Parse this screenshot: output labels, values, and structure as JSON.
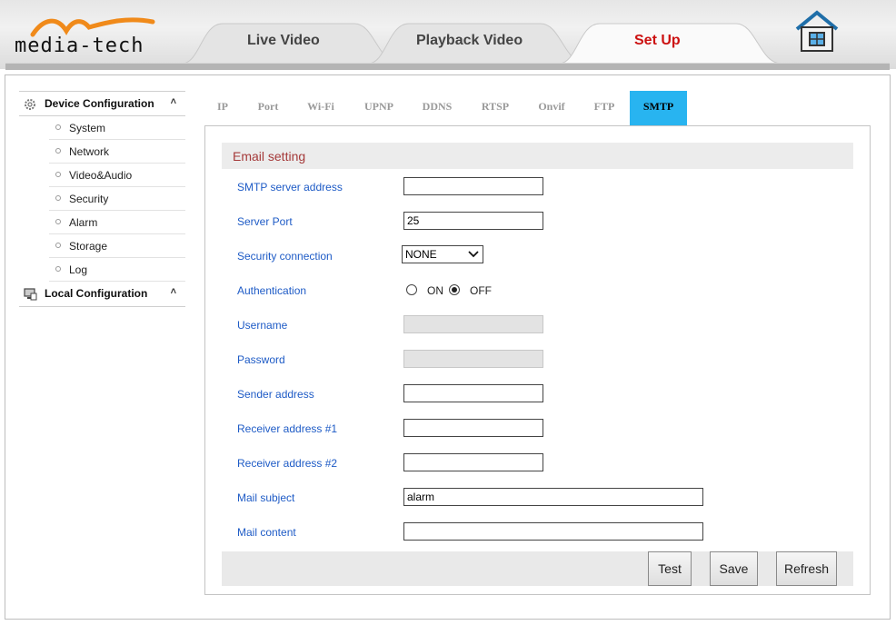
{
  "header": {
    "logo_text": "media-tech",
    "tabs": [
      {
        "label": "Live Video",
        "active": false
      },
      {
        "label": "Playback Video",
        "active": false
      },
      {
        "label": "Set Up",
        "active": true
      }
    ],
    "home_icon": "home-icon",
    "colors": {
      "active_tab_text": "#cc1111",
      "inactive_tab_text": "#444444"
    }
  },
  "sidebar": {
    "device_config": {
      "label": "Device Configuration",
      "icon": "gear-icon",
      "items": [
        {
          "label": "System"
        },
        {
          "label": "Network"
        },
        {
          "label": "Video&Audio"
        },
        {
          "label": "Security"
        },
        {
          "label": "Alarm"
        },
        {
          "label": "Storage"
        },
        {
          "label": "Log"
        }
      ]
    },
    "local_config": {
      "label": "Local Configuration",
      "icon": "monitor-icon"
    }
  },
  "subtabs": {
    "items": [
      "IP",
      "Port",
      "Wi-Fi",
      "UPNP",
      "DDNS",
      "RTSP",
      "Onvif",
      "FTP",
      "SMTP"
    ],
    "active": "SMTP",
    "active_color": "#28b4f0"
  },
  "email": {
    "section_title": "Email setting",
    "smtp_server_label": "SMTP server address",
    "smtp_server_value": "",
    "server_port_label": "Server Port",
    "server_port_value": "25",
    "security_label": "Security connection",
    "security_value": "NONE",
    "auth_label": "Authentication",
    "auth_on_label": "ON",
    "auth_off_label": "OFF",
    "auth_selected": "OFF",
    "username_label": "Username",
    "username_value": "",
    "password_label": "Password",
    "password_value": "",
    "sender_label": "Sender address",
    "sender_value": "",
    "receiver1_label": "Receiver address #1",
    "receiver1_value": "",
    "receiver2_label": "Receiver address #2",
    "receiver2_value": "",
    "subject_label": "Mail subject",
    "subject_value": "alarm",
    "content_label": "Mail content",
    "content_value": ""
  },
  "buttons": {
    "test": "Test",
    "save": "Save",
    "refresh": "Refresh"
  }
}
